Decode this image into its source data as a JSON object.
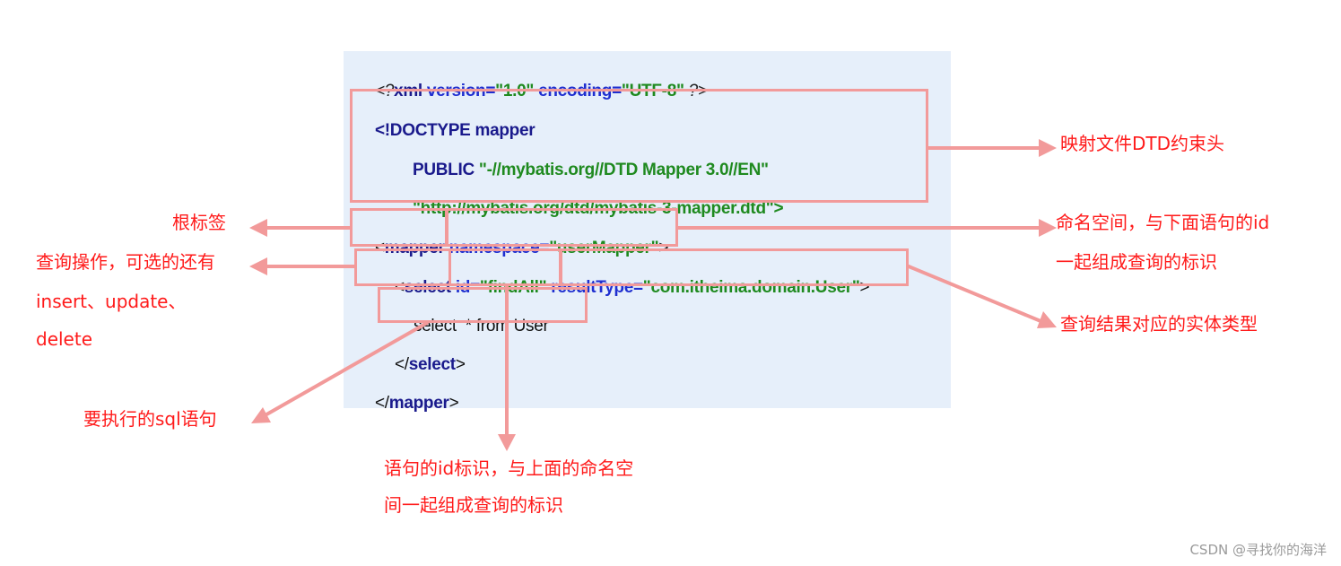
{
  "code": {
    "line1": {
      "pi_open": "<?",
      "kw": "xml",
      "a1": " version=",
      "v1": "\"1.0\"",
      "a2": " encoding=",
      "v2": "\"UTF-8\"",
      "pi_close": " ?>"
    },
    "line2": "<!DOCTYPE mapper",
    "line3": {
      "kw": "PUBLIC",
      "str": " \"-//mybatis.org//DTD Mapper 3.0//EN\""
    },
    "line4": "\"http://mybatis.org/dtd/mybatis-3-mapper.dtd\">",
    "line5": {
      "open": "<",
      "kw": "mapper",
      "attr": " namespace=",
      "val": "\"userMapper\"",
      "close": ">"
    },
    "line6": {
      "open": "<",
      "kw": "select",
      "a1": " id=",
      "v1": "\"findAll\"",
      "a2": " resultType=",
      "v2": "\"com.itheima.domain.User\"",
      "close": ">"
    },
    "line7": "select  * from User",
    "line8": {
      "open": "</",
      "kw": "select",
      "close": ">"
    },
    "line9": {
      "open": "</",
      "kw": "mapper",
      "close": ">"
    }
  },
  "annotations": {
    "dtd": "映射文件DTD约束头",
    "root": "根标签",
    "namespace_l1": "命名空间，与下面语句的id",
    "namespace_l2": "一起组成查询的标识",
    "select_l1": "查询操作，可选的还有",
    "select_l2": "insert、update、",
    "select_l3": "delete",
    "result": "查询结果对应的实体类型",
    "sql": "要执行的sql语句",
    "id_l1": "语句的id标识，与上面的命名空",
    "id_l2": "间一起组成查询的标识"
  },
  "watermark": "CSDN @寻找你的海洋",
  "colors": {
    "panel": "#e6effa",
    "highlight": "#f29a9a",
    "annotation": "#ff1a1a",
    "keyword": "#1a1a8c",
    "attribute": "#1f2fd0",
    "string": "#1f8a1f"
  }
}
